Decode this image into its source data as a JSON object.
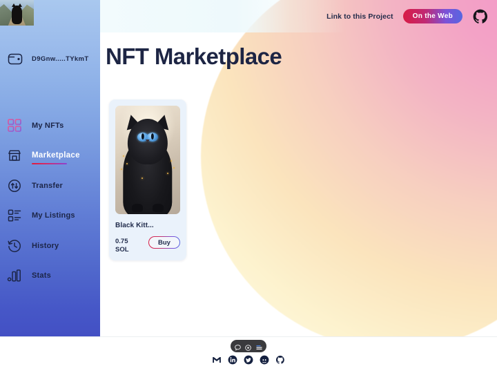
{
  "sidebar": {
    "thumbnail_alt": "black-cat-photo",
    "wallet": {
      "icon": "wallet-icon",
      "address": "D9Gnw.....TYkmT"
    },
    "items": [
      {
        "label": "My NFTs",
        "icon": "grid-icon",
        "active": false
      },
      {
        "label": "Marketplace",
        "icon": "store-icon",
        "active": true
      },
      {
        "label": "Transfer",
        "icon": "transfer-icon",
        "active": false
      },
      {
        "label": "My Listings",
        "icon": "list-icon",
        "active": false
      },
      {
        "label": "History",
        "icon": "clock-icon",
        "active": false
      },
      {
        "label": "Stats",
        "icon": "chart-icon",
        "active": false
      }
    ]
  },
  "topbar": {
    "link_label": "Link to this Project",
    "web_button": "On the Web",
    "github_icon": "github-icon"
  },
  "main": {
    "title": "NFT Marketplace",
    "cards": [
      {
        "name": "Black Kitt...",
        "price": "0.75",
        "currency": "SOL",
        "buy_label": "Buy",
        "image_alt": "black-kitten-nft"
      }
    ]
  },
  "bottom": {
    "pill_icons": [
      "chat-bubble-icon",
      "eye-target-icon",
      "list-lines-icon"
    ],
    "social_icons": [
      "gmail-icon",
      "linkedin-icon",
      "twitter-icon",
      "discord-icon",
      "github-icon"
    ]
  },
  "colors": {
    "accent_red": "#d81b45",
    "accent_blue": "#5766e0",
    "sidebar_top": "#a9c8ef",
    "sidebar_bottom": "#4350c4",
    "title_navy": "#1d2544",
    "blob_pink": "#f49ac8",
    "blob_cream": "#fefbe8"
  }
}
